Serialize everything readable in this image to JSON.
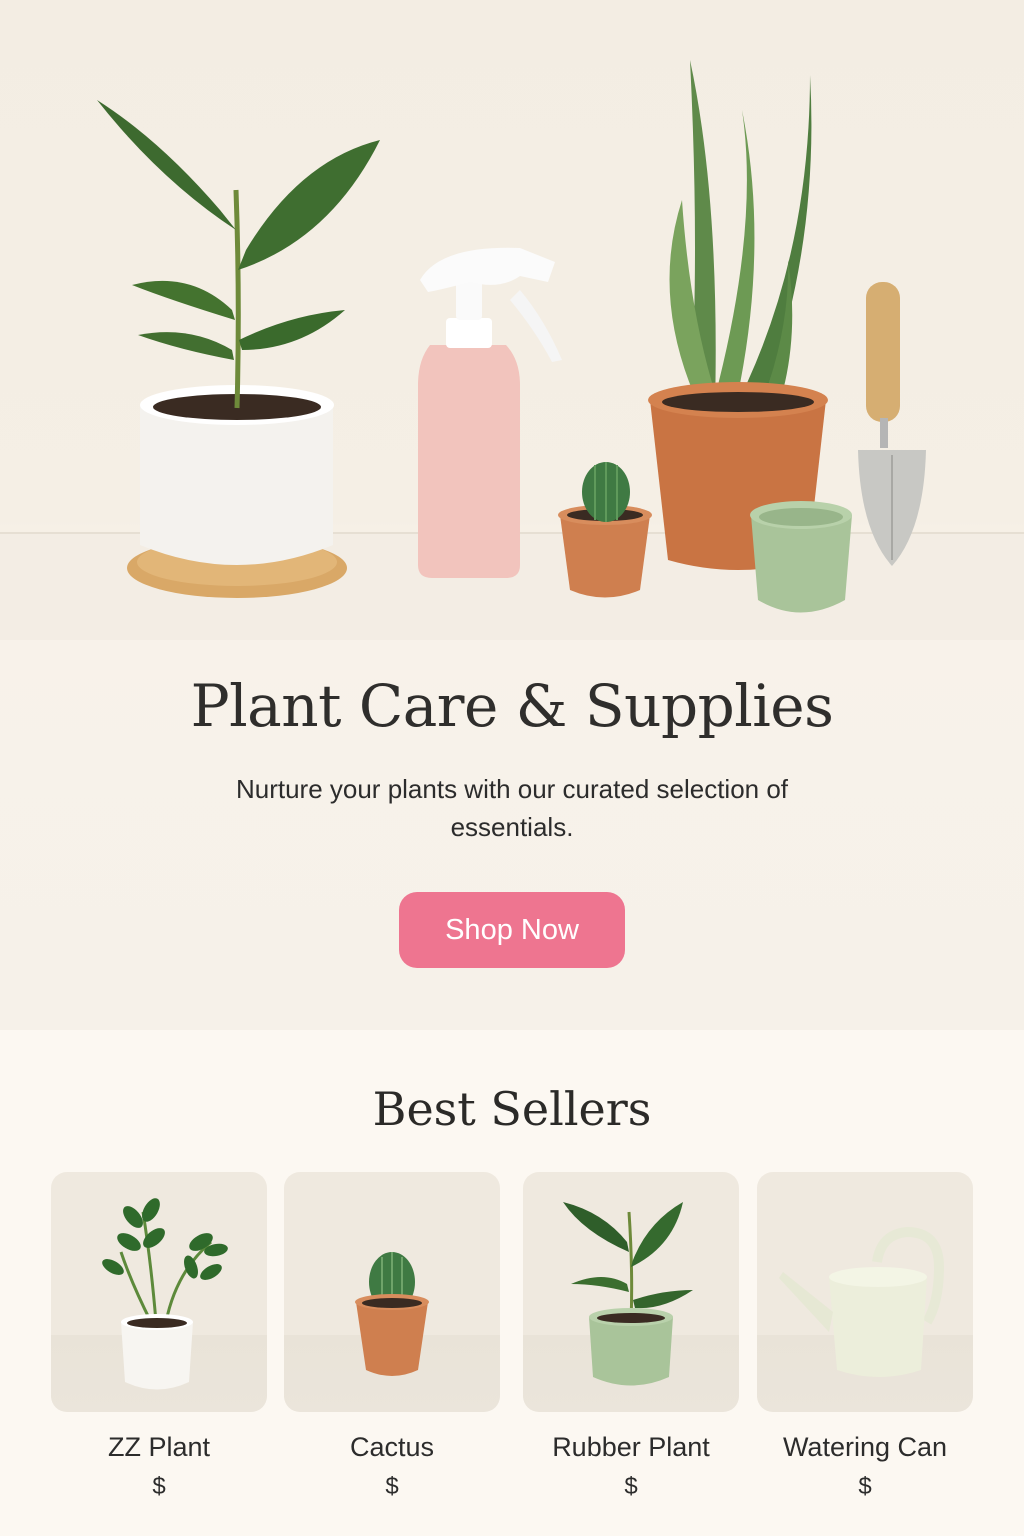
{
  "hero": {
    "title": "Plant Care & Supplies",
    "subtitle": "Nurture your plants with our curated selection of essentials.",
    "cta_label": "Shop Now"
  },
  "best_sellers": {
    "title": "Best Sellers",
    "products": [
      {
        "name": "ZZ Plant",
        "price": "$",
        "image": "zz-plant-white-pot"
      },
      {
        "name": "Cactus",
        "price": "$",
        "image": "cactus-terracotta-pot"
      },
      {
        "name": "Rubber Plant",
        "price": "$",
        "image": "rubber-plant-green-pot"
      },
      {
        "name": "Watering Can",
        "price": "$",
        "image": "watering-can-cream"
      }
    ]
  },
  "colors": {
    "accent": "#ee7590",
    "background": "#fbf7f0",
    "terracotta": "#cf7f4f",
    "sage": "#a9c49a",
    "blush": "#f2c4bd"
  }
}
